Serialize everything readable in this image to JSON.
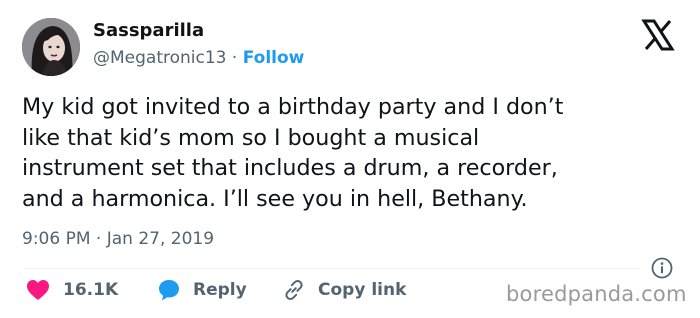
{
  "author": {
    "display_name": "Sassparilla",
    "handle": "@Megatronic13",
    "separator": "·",
    "follow_label": "Follow"
  },
  "tweet": {
    "lines": [
      "My kid got invited to a birthday party and I don’t",
      "like that kid’s mom so I bought a musical",
      "instrument set that includes a drum, a recorder,",
      "and a harmonica. I’ll see you in hell, Bethany."
    ],
    "time": "9:06 PM",
    "date_separator": "·",
    "date": "Jan 27, 2019"
  },
  "actions": {
    "like_count": "16.1K",
    "reply_label": "Reply",
    "copy_link_label": "Copy link"
  },
  "watermark": "boredpanda.com",
  "icons": {
    "like": "heart-icon",
    "reply": "speech-bubble-icon",
    "copy": "link-icon",
    "info": "info-icon",
    "brand": "x-logo-icon"
  },
  "colors": {
    "accent": "#1d9bf0",
    "like": "#f91880",
    "text": "#0f1419",
    "muted": "#536471",
    "watermark": "#9a9a9a"
  }
}
